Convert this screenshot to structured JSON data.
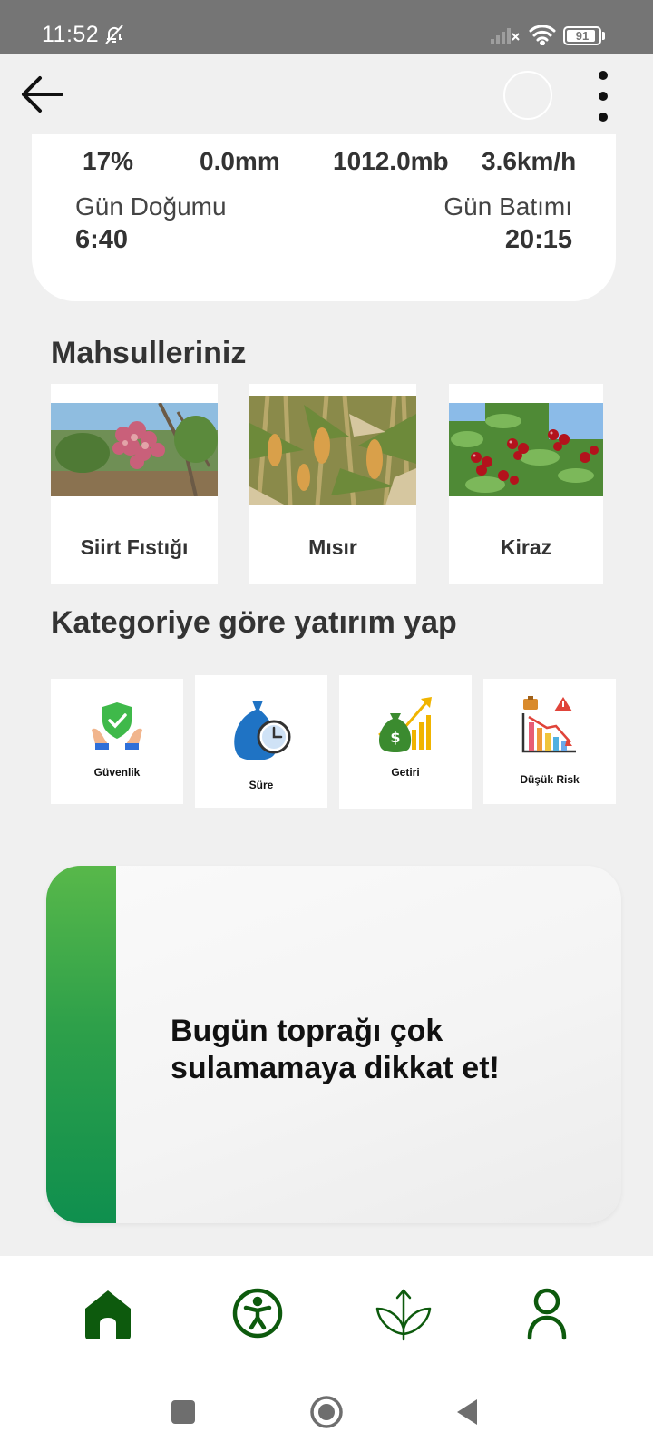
{
  "status": {
    "time": "11:52",
    "battery": "91",
    "battery_level": 0.91
  },
  "weather": {
    "humidity": "17%",
    "rain": "0.0mm",
    "pressure": "1012.0mb",
    "wind": "3.6km/h",
    "sunrise_label": "Gün Doğumu",
    "sunrise_time": "6:40",
    "sunset_label": "Gün Batımı",
    "sunset_time": "20:15"
  },
  "crops": {
    "title": "Mahsulleriniz",
    "items": [
      {
        "label": "Siirt Fıstığı"
      },
      {
        "label": "Mısır"
      },
      {
        "label": "Kiraz"
      }
    ]
  },
  "categories": {
    "title": "Kategoriye göre yatırım yap",
    "items": [
      {
        "label": "Güvenlik",
        "icon": "shield-hands-icon"
      },
      {
        "label": "Süre",
        "icon": "money-bag-clock-icon"
      },
      {
        "label": "Getiri",
        "icon": "money-growth-icon"
      },
      {
        "label": "Düşük Risk",
        "icon": "risk-chart-icon"
      }
    ]
  },
  "tip": {
    "text": "Bugün toprağı çok sulamamaya dikkat et!"
  },
  "nav": {
    "items": [
      {
        "icon": "home-icon",
        "active": true
      },
      {
        "icon": "accessibility-icon"
      },
      {
        "icon": "sprout-icon"
      },
      {
        "icon": "person-icon"
      }
    ]
  },
  "colors": {
    "accent": "#0d5a0d",
    "stripe": "#2ea04a",
    "statusbar": "#757575"
  }
}
